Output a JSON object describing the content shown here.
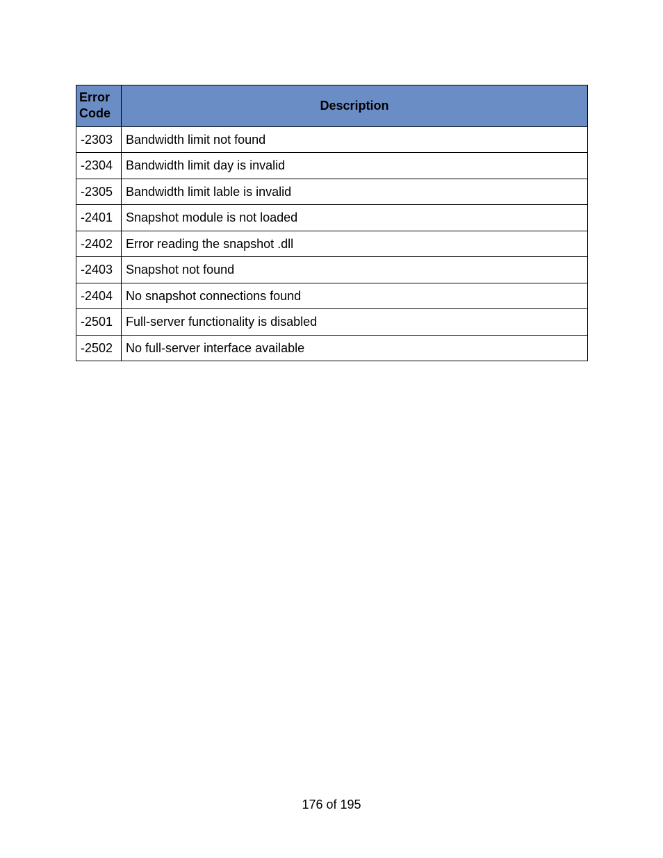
{
  "table": {
    "headers": {
      "code": "Error Code",
      "description": "Description"
    },
    "rows": [
      {
        "code": "-2303",
        "description": "Bandwidth limit not found"
      },
      {
        "code": "-2304",
        "description": "Bandwidth limit day is invalid"
      },
      {
        "code": "-2305",
        "description": "Bandwidth limit lable is invalid"
      },
      {
        "code": "-2401",
        "description": "Snapshot module is not loaded"
      },
      {
        "code": "-2402",
        "description": "Error reading the snapshot .dll"
      },
      {
        "code": "-2403",
        "description": "Snapshot not found"
      },
      {
        "code": "-2404",
        "description": "No snapshot connections found"
      },
      {
        "code": "-2501",
        "description": "Full-server functionality is disabled"
      },
      {
        "code": "-2502",
        "description": "No full-server interface available"
      }
    ]
  },
  "footer": {
    "page_info": "176 of 195"
  }
}
